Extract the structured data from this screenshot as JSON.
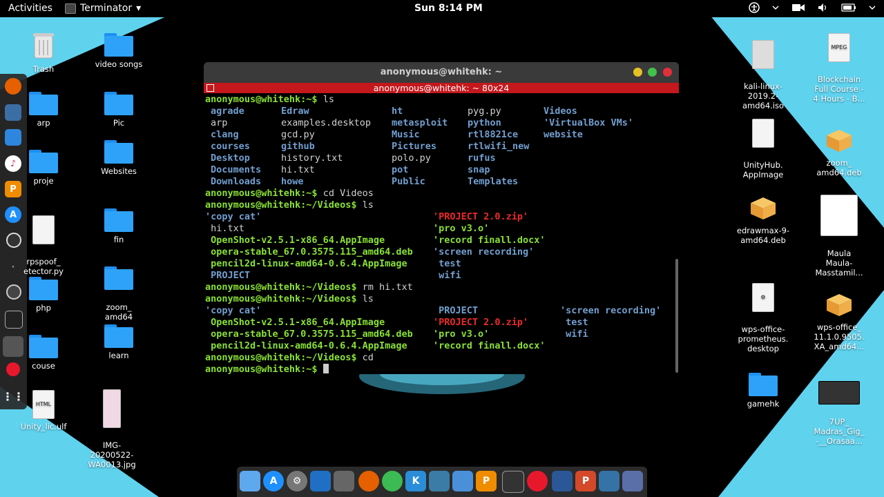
{
  "topbar": {
    "activities": "Activities",
    "app_name": "Terminator",
    "app_menu_arrow": "▾",
    "clock": "Sun  8:14 PM"
  },
  "terminal": {
    "title": "anonymous@whitehk: ~",
    "tab_title": "anonymous@whitehk: ~ 80x24",
    "lines": [
      {
        "prompt": "anonymous@whitehk:~$ ",
        "cmd": "ls"
      },
      {
        "cols": [
          [
            "agrade",
            "d"
          ],
          [
            "Edraw",
            "d"
          ],
          [
            "ht",
            "d"
          ],
          [
            "pyg.py",
            "w"
          ],
          [
            "Videos",
            "d"
          ]
        ]
      },
      {
        "cols": [
          [
            "arp",
            "w"
          ],
          [
            "examples.desktop",
            "w"
          ],
          [
            "metasploit",
            "d"
          ],
          [
            "python",
            "d"
          ],
          [
            "'VirtualBox VMs'",
            "d"
          ]
        ]
      },
      {
        "cols": [
          [
            "clang",
            "d"
          ],
          [
            "gcd.py",
            "w"
          ],
          [
            "Music",
            "d"
          ],
          [
            "rtl8821ce",
            "d"
          ],
          [
            "website",
            "d"
          ]
        ]
      },
      {
        "cols": [
          [
            "courses",
            "d"
          ],
          [
            "github",
            "d"
          ],
          [
            "Pictures",
            "d"
          ],
          [
            "rtlwifi_new",
            "d"
          ],
          [
            "",
            ""
          ]
        ]
      },
      {
        "cols": [
          [
            "Desktop",
            "d"
          ],
          [
            "history.txt",
            "w"
          ],
          [
            "polo.py",
            "w"
          ],
          [
            "rufus",
            "d"
          ],
          [
            "",
            ""
          ]
        ]
      },
      {
        "cols": [
          [
            "Documents",
            "d"
          ],
          [
            "hi.txt",
            "w"
          ],
          [
            "pot",
            "d"
          ],
          [
            "snap",
            "d"
          ],
          [
            "",
            ""
          ]
        ]
      },
      {
        "cols": [
          [
            "Downloads",
            "d"
          ],
          [
            "howe",
            "d"
          ],
          [
            "Public",
            "d"
          ],
          [
            "Templates",
            "d"
          ],
          [
            "",
            ""
          ]
        ]
      },
      {
        "prompt": "anonymous@whitehk:~$ ",
        "cmd": "cd Videos"
      },
      {
        "prompt": "anonymous@whitehk:~/Videos$ ",
        "cmd": "ls"
      },
      {
        "vcols": [
          [
            "'copy cat'",
            "d"
          ],
          [
            "'PROJECT 2.0.zip'",
            "r"
          ]
        ]
      },
      {
        "vcols": [
          [
            " hi.txt",
            "w"
          ],
          [
            "'pro v3.o'",
            "a"
          ]
        ]
      },
      {
        "vcols": [
          [
            " OpenShot-v2.5.1-x86_64.AppImage",
            "g"
          ],
          [
            "'record finall.docx'",
            "a"
          ]
        ]
      },
      {
        "vcols": [
          [
            " opera-stable_67.0.3575.115_amd64.deb",
            "g"
          ],
          [
            "'screen recording'",
            "d"
          ]
        ]
      },
      {
        "vcols": [
          [
            " pencil2d-linux-amd64-0.6.4.AppImage",
            "g"
          ],
          [
            " test",
            "d"
          ]
        ]
      },
      {
        "vcols": [
          [
            " PROJECT",
            "d"
          ],
          [
            " wifi",
            "d"
          ]
        ]
      },
      {
        "prompt": "anonymous@whitehk:~/Videos$ ",
        "cmd": "rm hi.txt"
      },
      {
        "prompt": "anonymous@whitehk:~/Videos$ ",
        "cmd": "ls"
      },
      {
        "ucols": [
          [
            "'copy cat'",
            "d"
          ],
          [
            " PROJECT",
            "d"
          ],
          [
            "'screen recording'",
            "d"
          ]
        ]
      },
      {
        "ucols": [
          [
            " OpenShot-v2.5.1-x86_64.AppImage",
            "g"
          ],
          [
            "'PROJECT 2.0.zip'",
            "r"
          ],
          [
            " test",
            "d"
          ]
        ]
      },
      {
        "ucols": [
          [
            " opera-stable_67.0.3575.115_amd64.deb",
            "g"
          ],
          [
            "'pro v3.o'",
            "a"
          ],
          [
            " wifi",
            "d"
          ]
        ]
      },
      {
        "ucols": [
          [
            " pencil2d-linux-amd64-0.6.4.AppImage",
            "g"
          ],
          [
            "'record finall.docx'",
            "a"
          ],
          [
            "",
            ""
          ]
        ]
      },
      {
        "prompt": "anonymous@whitehk:~/Videos$ ",
        "cmd": "cd"
      },
      {
        "prompt": "anonymous@whitehk:~$ ",
        "cmd": ""
      }
    ]
  },
  "desktop_left": [
    {
      "label": "Trash",
      "icon": "trash-icon"
    },
    {
      "label": "video songs",
      "icon": "folder-icon"
    },
    {
      "label": "arp",
      "icon": "folder-icon"
    },
    {
      "label": "Pic",
      "icon": "folder-icon"
    },
    {
      "label": "proje",
      "icon": "folder-icon"
    },
    {
      "label": "Websites",
      "icon": "folder-icon"
    },
    {
      "label": "rpspoof_\netector.py",
      "icon": "python-file-icon"
    },
    {
      "label": "fin",
      "icon": "folder-icon"
    },
    {
      "label": "php",
      "icon": "folder-icon"
    },
    {
      "label": "zoom_\namd64",
      "icon": "folder-icon"
    },
    {
      "label": "couse",
      "icon": "folder-icon"
    },
    {
      "label": "learn",
      "icon": "folder-icon"
    },
    {
      "label": "Unity_lic.ulf",
      "icon": "html-file-icon"
    },
    {
      "label": "IMG-\n20200522-\nWA0013.jpg",
      "icon": "image-file-icon"
    }
  ],
  "desktop_right": [
    {
      "label": "kali-linux-\n2019.2-\namd64.iso",
      "icon": "disc-image-icon"
    },
    {
      "label": "Blockchain\nFull Course -\n4 Hours - B...",
      "icon": "mpeg-file-icon"
    },
    {
      "label": "UnityHub.\nAppImage",
      "icon": "appimage-icon"
    },
    {
      "label": "zoom_\namd64.deb",
      "icon": "package-icon"
    },
    {
      "label": "edrawmax-9-\namd64.deb",
      "icon": "package-icon"
    },
    {
      "label": "Maula\nMaula-\nMasstamil...",
      "icon": "image-file-icon"
    },
    {
      "label": "wps-office-\nprometheus.\ndesktop",
      "icon": "settings-file-icon"
    },
    {
      "label": "wps-office_\n11.1.0.9505.\nXA_amd64...",
      "icon": "package-icon"
    },
    {
      "label": "gamehk",
      "icon": "folder-icon"
    },
    {
      "label": "7UP_\nMadras_Gig_\n-__Orasaa...",
      "icon": "video-file-icon"
    }
  ],
  "colors": {
    "desktop": "#5fd2ee",
    "terminal_tab": "#c4181d",
    "prompt": "#8ae234",
    "directory": "#729fcf"
  }
}
